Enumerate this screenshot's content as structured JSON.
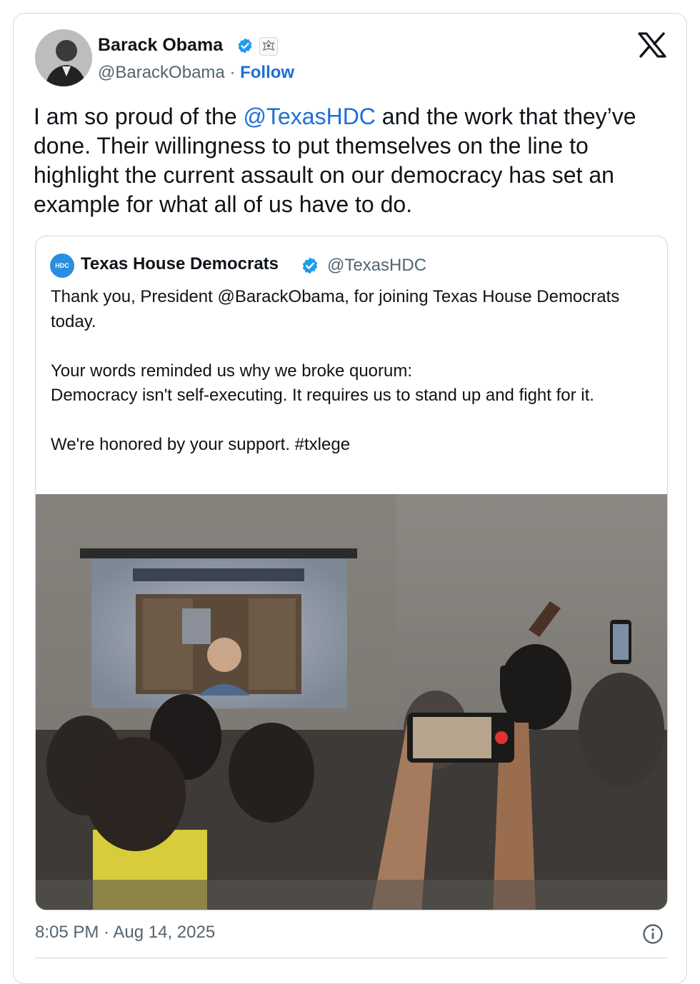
{
  "tweet": {
    "author": {
      "name": "Barack Obama",
      "handle": "@BarackObama",
      "separator": "·",
      "follow_label": "Follow"
    },
    "text": {
      "part1": "I am so proud of the ",
      "mention": "@TexasHDC",
      "part2": " and the work that they’ve done. Their willingness to put themselves on the line to highlight the current assault on our democracy has set an example for what all of us have to do."
    },
    "quoted": {
      "avatar_text": "HDC",
      "name": "Texas House Democrats",
      "handle": "@TexasHDC",
      "text": "Thank you, President @BarackObama, for joining Texas House Democrats today.\n\nYour words reminded us why we broke quorum:\nDemocracy isn't self-executing. It requires us to stand up and fight for it.\n\nWe're honored by your support. #txlege"
    },
    "timestamp": "8:05 PM · Aug 14, 2025"
  },
  "icons": {
    "verified": "verified-badge-icon",
    "affiliation": "government-seal-icon",
    "platform": "x-logo-icon",
    "info": "info-icon"
  },
  "colors": {
    "link": "#1d6fd6",
    "verified": "#1d9bf0",
    "muted_text": "#536471",
    "border": "#cfd9de"
  }
}
